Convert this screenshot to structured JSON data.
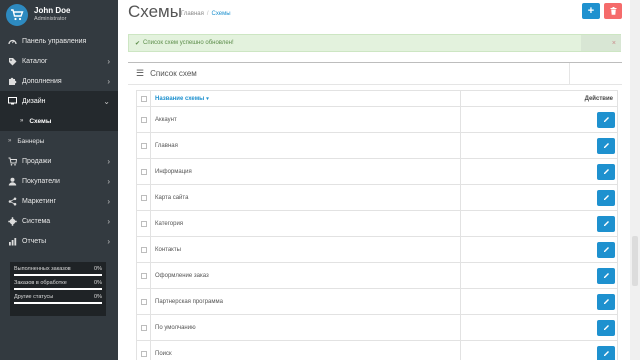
{
  "user": {
    "name": "John Doe",
    "role": "Administrator"
  },
  "sidebar": {
    "items": [
      {
        "label": "Панель управления",
        "icon": "dashboard-icon",
        "chevron": false
      },
      {
        "label": "Каталог",
        "icon": "tag-icon",
        "chevron": true
      },
      {
        "label": "Дополнения",
        "icon": "puzzle-icon",
        "chevron": true
      },
      {
        "label": "Дизайн",
        "icon": "monitor-icon",
        "chevron": true,
        "active": true
      },
      {
        "label": "Продажи",
        "icon": "cart-icon",
        "chevron": true
      },
      {
        "label": "Покупатели",
        "icon": "user-icon",
        "chevron": true
      },
      {
        "label": "Маркетинг",
        "icon": "share-icon",
        "chevron": true
      },
      {
        "label": "Система",
        "icon": "gear-icon",
        "chevron": true
      },
      {
        "label": "Отчеты",
        "icon": "chart-icon",
        "chevron": true
      }
    ],
    "submenu": [
      {
        "label": "Схемы",
        "current": true
      },
      {
        "label": "Баннеры",
        "current": false
      }
    ],
    "stats": [
      {
        "label": "Выполненных заказов",
        "value": "0%"
      },
      {
        "label": "Заказов в обработке",
        "value": "0%"
      },
      {
        "label": "Другие статусы",
        "value": "0%"
      }
    ]
  },
  "header": {
    "title": "Схемы",
    "breadcrumb": [
      "Главная",
      "Схемы"
    ],
    "breadcrumb_separator": "/"
  },
  "alert": {
    "text": "Список схем успешно обновлен!",
    "close": "×"
  },
  "panel": {
    "title": "Список схем",
    "columns": {
      "name": "Название схемы",
      "action": "Действие"
    },
    "rows": [
      "Аккаунт",
      "Главная",
      "Информация",
      "Карта сайта",
      "Категория",
      "Контакты",
      "Оформление заказ",
      "Партнерская программа",
      "По умолчанию",
      "Поиск"
    ]
  },
  "colors": {
    "sidebar_bg": "#333a40",
    "accent": "#1e91cf",
    "danger": "#f56b6b",
    "success_bg": "#e3f2dd"
  }
}
